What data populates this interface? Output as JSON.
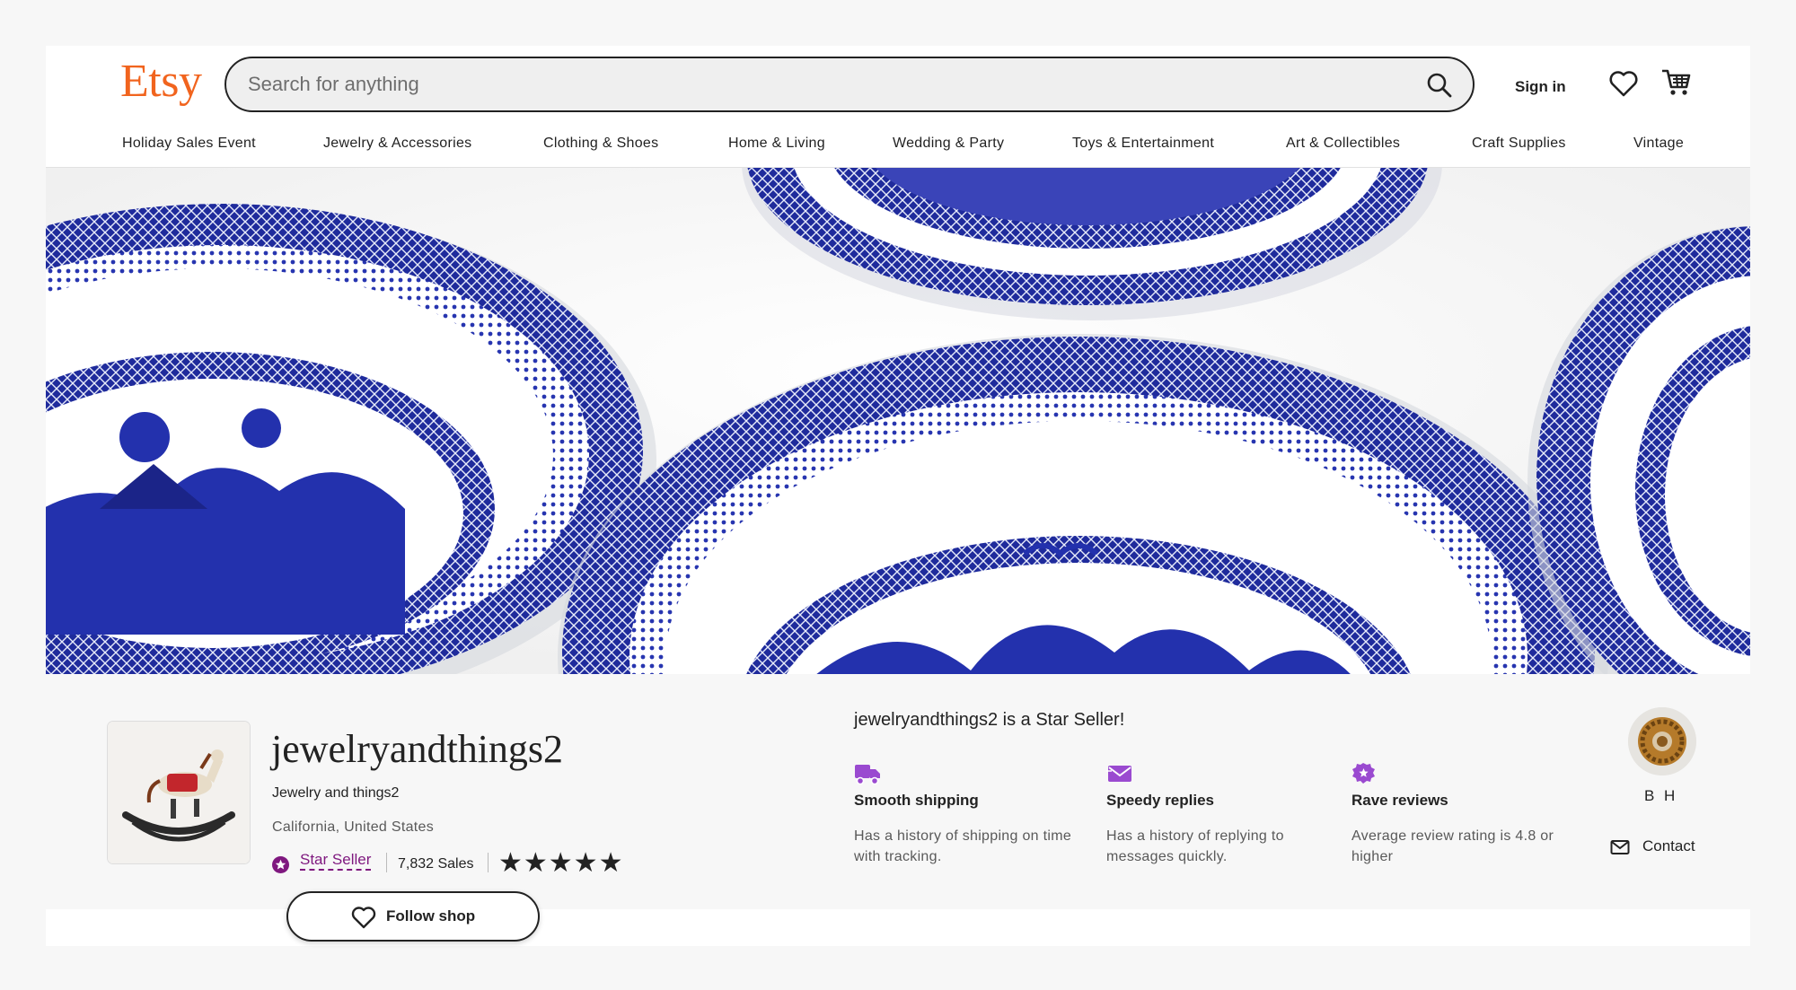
{
  "header": {
    "logo": "Etsy",
    "search_placeholder": "Search for anything",
    "sign_in": "Sign in"
  },
  "nav": {
    "items": [
      "Holiday Sales Event",
      "Jewelry & Accessories",
      "Clothing & Shoes",
      "Home & Living",
      "Wedding & Party",
      "Toys & Entertainment",
      "Art & Collectibles",
      "Craft Supplies",
      "Vintage"
    ]
  },
  "shop": {
    "name": "jewelryandthings2",
    "title": "Jewelry and things2",
    "location": "California, United States",
    "star_seller_label": "Star Seller",
    "sales": "7,832 Sales",
    "rating_stars": "★★★★★",
    "follow_label": "Follow shop"
  },
  "star_seller": {
    "headline": "jewelryandthings2 is a Star Seller!",
    "features": [
      {
        "icon": "truck-icon",
        "title": "Smooth shipping",
        "desc": "Has a history of shipping on time with tracking."
      },
      {
        "icon": "envelope-icon",
        "title": "Speedy replies",
        "desc": "Has a history of replying to messages quickly."
      },
      {
        "icon": "star-badge-icon",
        "title": "Rave reviews",
        "desc": "Average review rating is 4.8 or higher"
      }
    ]
  },
  "owner": {
    "name": "B H",
    "contact_label": "Contact"
  },
  "colors": {
    "brand": "#f1641e",
    "star_seller_purple": "#7f187f",
    "plate_blue": "#1e2aa0"
  }
}
